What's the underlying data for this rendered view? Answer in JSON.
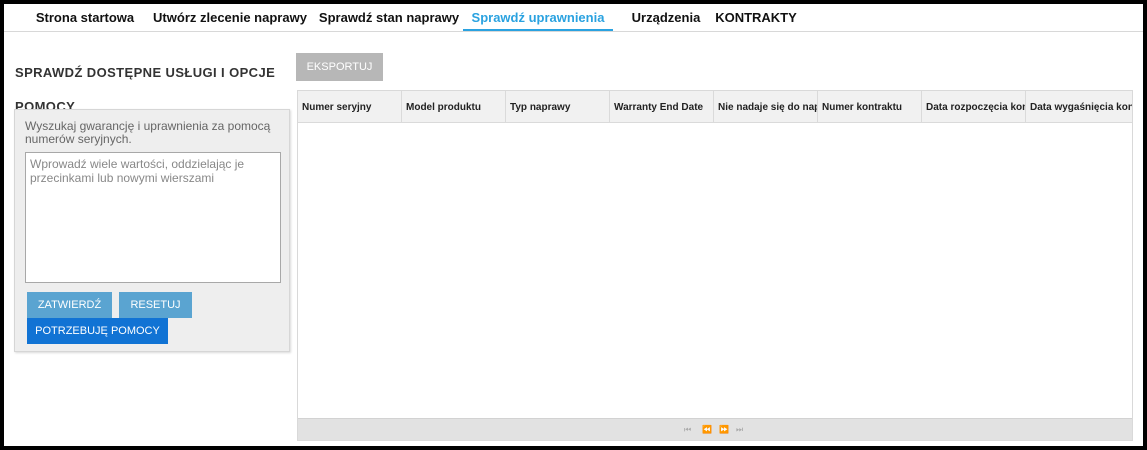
{
  "nav": {
    "items": [
      {
        "label": "Strona startowa"
      },
      {
        "label": "Utwórz zlecenie naprawy"
      },
      {
        "label": "Sprawdź stan naprawy"
      },
      {
        "label": "Sprawdź uprawnienia"
      },
      {
        "label": "Urządzenia"
      },
      {
        "label": "KONTRAKTY"
      }
    ],
    "active_index": 3
  },
  "panel": {
    "title": "Sprawdź dostępne usługi i opcje pomocy",
    "description": "Wyszukaj gwarancję i uprawnienia za pomocą numerów seryjnych.",
    "input_placeholder": "Wprowadź wiele wartości, oddzielając je przecinkami lub nowymi wierszami",
    "input_value": "",
    "submit_label": "Zatwierdź",
    "reset_label": "Resetuj",
    "help_label": "Potrzebuję pomocy"
  },
  "grid": {
    "export_label": "Eksportuj",
    "columns": [
      "Numer seryjny",
      "Model produktu",
      "Typ naprawy",
      "Warranty End Date",
      "Nie nadaje się do napr",
      "Numer kontraktu",
      "Data rozpoczęcia kont",
      "Data wygaśnięcia kont"
    ],
    "rows": [],
    "pager": {
      "first": "⏮",
      "prev": "⏪",
      "next": "⏩",
      "last": "⏭"
    }
  },
  "colors": {
    "accent": "#2aa2e0",
    "button": "#5aa4d1",
    "button_primary": "#1173d4",
    "button_disabled": "#b7b7b7"
  },
  "icons": {
    "pager_first": "first-page-icon",
    "pager_prev": "previous-page-icon",
    "pager_next": "next-page-icon",
    "pager_last": "last-page-icon"
  }
}
